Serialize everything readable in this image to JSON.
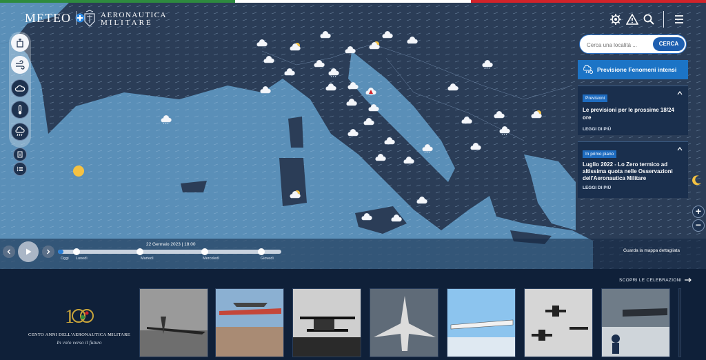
{
  "header": {
    "logo_text": "METEO",
    "org_line1": "AERONAUTICA",
    "org_line2": "MILITARE"
  },
  "search": {
    "placeholder": "Cerca una località ...",
    "button_label": "CERCA"
  },
  "alerts_button": "Previsione Fenomeni intensi",
  "cards": [
    {
      "badge": "Previsioni",
      "title": "Le previsioni per le prossime 18/24 ore",
      "link": "LEGGI DI PIÙ"
    },
    {
      "badge": "In primo piano",
      "title": "Luglio 2022 - Lo Zero termico ad altissima quota nelle Osservazioni dell'Aeronautica Militare",
      "link": "LEGGI DI PIÙ"
    }
  ],
  "timeline": {
    "current": "22 Gennaio 2023 | 18:00",
    "days": [
      "Oggi",
      "Lunedì",
      "Martedì",
      "Mercoledì",
      "Giovedì"
    ],
    "progress": 0.0
  },
  "map_detail_link": "Guarda la mappa dettagliata",
  "celebrations_link": "SCOPRI LE CELEBRAZIONI",
  "centenary": {
    "title": "CENTO ANNI DELL'AERONAUTICA MILITARE",
    "subtitle": "In volo verso il futuro"
  },
  "zoom": {
    "in": "+",
    "out": "−"
  },
  "icons": [
    "settings-icon",
    "alert-icon",
    "search-icon",
    "menu-icon"
  ],
  "colors": {
    "flag_green": "#2e8b3f",
    "flag_white": "#ffffff",
    "flag_red": "#d2232a",
    "accent": "#1e6cc0",
    "sea": "#5a8fb8",
    "land": "#2b3f5a"
  }
}
